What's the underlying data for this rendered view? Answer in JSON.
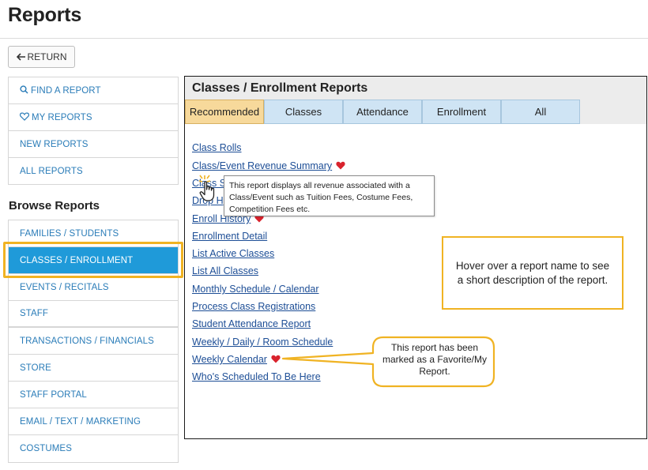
{
  "page": {
    "title": "Reports"
  },
  "return_button": {
    "label": "RETURN",
    "icon": "arrow-left-icon"
  },
  "sidebar": {
    "top_items": [
      {
        "label": "FIND A REPORT",
        "icon": "search-icon"
      },
      {
        "label": "MY REPORTS",
        "icon": "heart-outline-icon"
      },
      {
        "label": "NEW REPORTS"
      },
      {
        "label": "ALL REPORTS"
      }
    ],
    "browse_heading": "Browse Reports",
    "browse_items": [
      {
        "label": "FAMILIES / STUDENTS"
      },
      {
        "label": "CLASSES / ENROLLMENT",
        "active": true
      },
      {
        "label": "EVENTS / RECITALS"
      },
      {
        "label": "STAFF"
      },
      {
        "label": "TRANSACTIONS / FINANCIALS"
      },
      {
        "label": "STORE"
      },
      {
        "label": "STAFF PORTAL"
      },
      {
        "label": "EMAIL / TEXT / MARKETING"
      },
      {
        "label": "COSTUMES"
      }
    ]
  },
  "panel": {
    "title": "Classes / Enrollment Reports",
    "tabs": [
      {
        "label": "Recommended",
        "active": true
      },
      {
        "label": "Classes"
      },
      {
        "label": "Attendance"
      },
      {
        "label": "Enrollment"
      },
      {
        "label": "All"
      }
    ],
    "reports": [
      {
        "label": "Class Rolls"
      },
      {
        "label": "Class/Event Revenue Summary",
        "favorite": true
      },
      {
        "label": "Class Ses"
      },
      {
        "label": "Drop H"
      },
      {
        "label": "Enroll History",
        "favorite": true
      },
      {
        "label": "Enrollment Detail"
      },
      {
        "label": "List Active Classes"
      },
      {
        "label": "List All Classes"
      },
      {
        "label": "Monthly Schedule / Calendar"
      },
      {
        "label": "Process Class Registrations"
      },
      {
        "label": "Student Attendance Report"
      },
      {
        "label": "Weekly / Daily / Room Schedule"
      },
      {
        "label": "Weekly Calendar",
        "favorite": true
      },
      {
        "label": "Who's Scheduled To Be Here"
      }
    ]
  },
  "tooltip": {
    "lines": [
      "This report displays all revenue associated with a",
      "Class/Event such as Tuition Fees, Costume Fees,",
      "Competition Fees etc."
    ]
  },
  "callouts": {
    "hover": "Hover over a report name to see a short description of the report.",
    "favorite": "This report has been marked as a Favorite/My Report."
  },
  "colors": {
    "accent_blue": "#1f9ad9",
    "link": "#1d4e96",
    "sidebar_link": "#2a7cb8",
    "callout_border": "#f0b323",
    "favorite_heart": "#d9232d",
    "tab_active": "#f7d99b",
    "tab_inactive": "#cfe4f4"
  }
}
